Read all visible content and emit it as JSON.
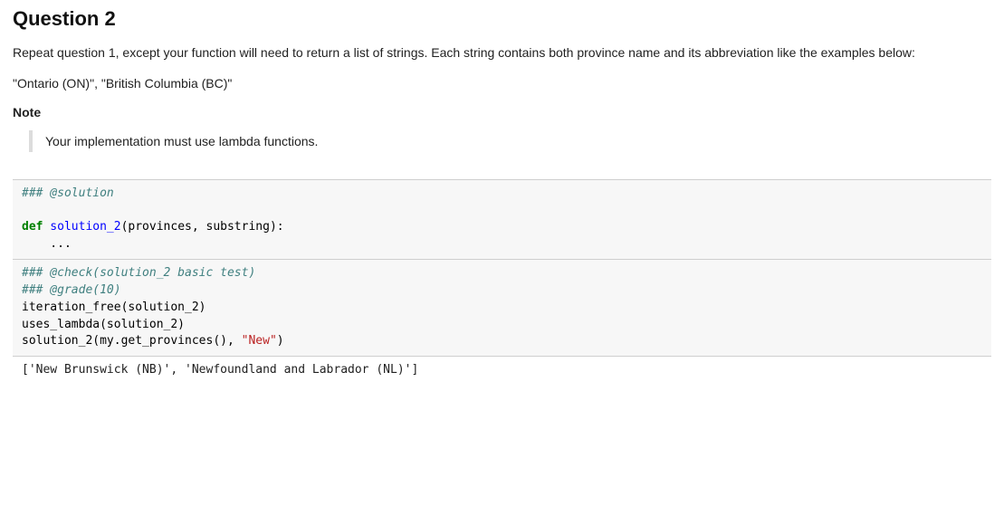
{
  "question": {
    "title": "Question 2",
    "description": "Repeat question 1, except your function will need to return a list of strings. Each string contains both province name and its abbreviation like the examples below:",
    "examples_line": "\"Ontario (ON)\", \"British Columbia (BC)\"",
    "note_label": "Note",
    "note_text": "Your implementation must use lambda functions."
  },
  "cell_solution": {
    "directive": "### @solution",
    "kw_def": "def",
    "fn_name": " solution_2",
    "params": "(provinces, substring):",
    "ellipsis": "    ..."
  },
  "cell_check": {
    "directive1": "### @check(solution_2 basic test)",
    "directive2": "### @grade(10)",
    "line1": "iteration_free(solution_2)",
    "line2": "uses_lambda(solution_2)",
    "line3_a": "solution_2(my.get_provinces(), ",
    "line3_str": "\"New\"",
    "line3_b": ")"
  },
  "output": {
    "text": "['New Brunswick (NB)', 'Newfoundland and Labrador (NL)']"
  }
}
